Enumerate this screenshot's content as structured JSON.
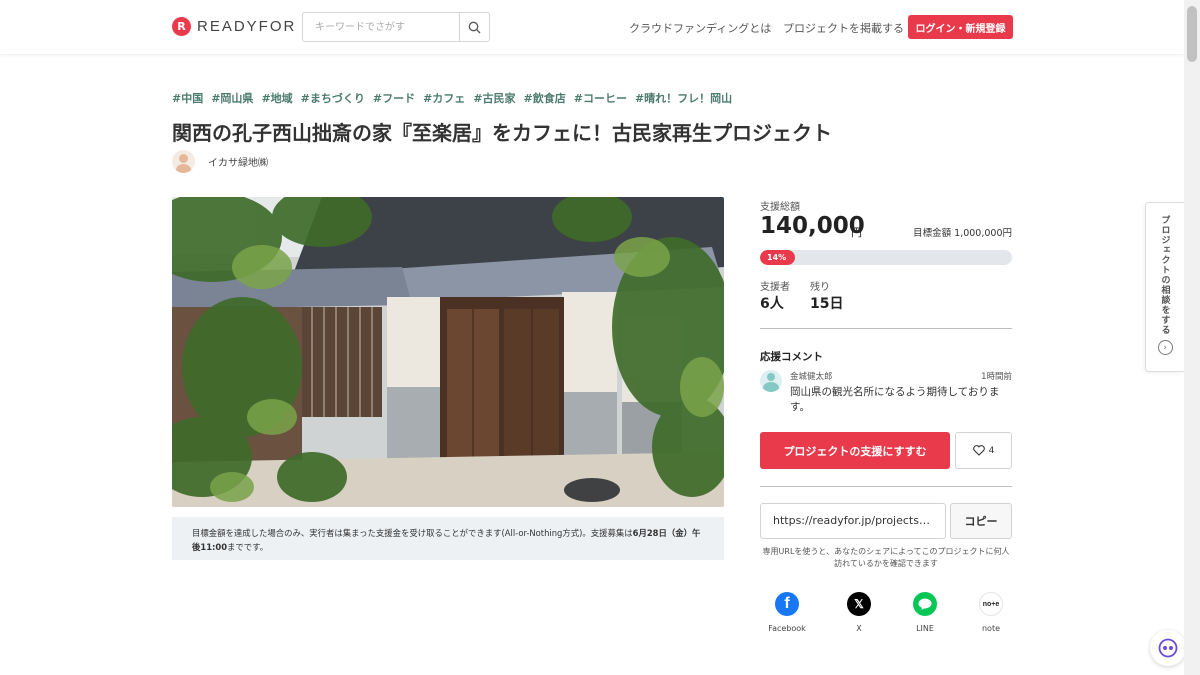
{
  "header": {
    "logo_text": "READYFOR",
    "search_placeholder": "キーワードでさがす",
    "nav_about": "クラウドファンディングとは",
    "nav_post": "プロジェクトを掲載する",
    "login_label": "ログイン・新規登録"
  },
  "project": {
    "tags": [
      "#中国",
      "#岡山県",
      "#地域",
      "#まちづくり",
      "#フード",
      "#カフェ",
      "#古民家",
      "#飲食店",
      "#コーヒー",
      "#晴れ！フレ！岡山"
    ],
    "title": "関西の孔子西山拙斎の家『至楽居』をカフェに！古民家再生プロジェクト",
    "owner_name": "イカサ緑地㈱",
    "note_prefix": "目標金額を達成した場合のみ、実行者は集まった支援金を受け取ることができます(All-or-Nothing方式)。支援募集は",
    "note_deadline": "6月28日（金）午後11:00",
    "note_suffix": "までです。"
  },
  "funding": {
    "total_label": "支援総額",
    "total_amount": "140,000",
    "total_unit": "円",
    "goal_text": "目標金額 1,000,000円",
    "progress_label": "14%",
    "progress_percent": 14,
    "supporters_label": "支援者",
    "supporters_value": "6人",
    "remaining_label": "残り",
    "remaining_value": "15日"
  },
  "comments": {
    "section_title": "応援コメント",
    "items": [
      {
        "name": "金城健太郎",
        "time": "1時間前",
        "body": "岡山県の観光名所になるよう期待しております。"
      }
    ]
  },
  "actions": {
    "support_label": "プロジェクトの支援にすすむ",
    "like_count": "4",
    "share_url": "https://readyfor.jp/projects/...",
    "copy_label": "コピー",
    "url_help": "専用URLを使うと、あなたのシェアによってこのプロジェクトに何人訪れているかを確認できます"
  },
  "share": {
    "facebook": "Facebook",
    "x": "X",
    "line": "LINE",
    "note": "note"
  },
  "side_tab": {
    "label": "プロジェクトの相談をする"
  },
  "colors": {
    "accent": "#e83a4b",
    "tag": "#4c7b6e",
    "facebook": "#1877f2",
    "line": "#06c755",
    "x": "#000000"
  },
  "icons": {
    "search": "search-icon",
    "heart": "heart-icon",
    "chat": "chat-bot-icon",
    "arrow": "chevron-right-icon"
  }
}
